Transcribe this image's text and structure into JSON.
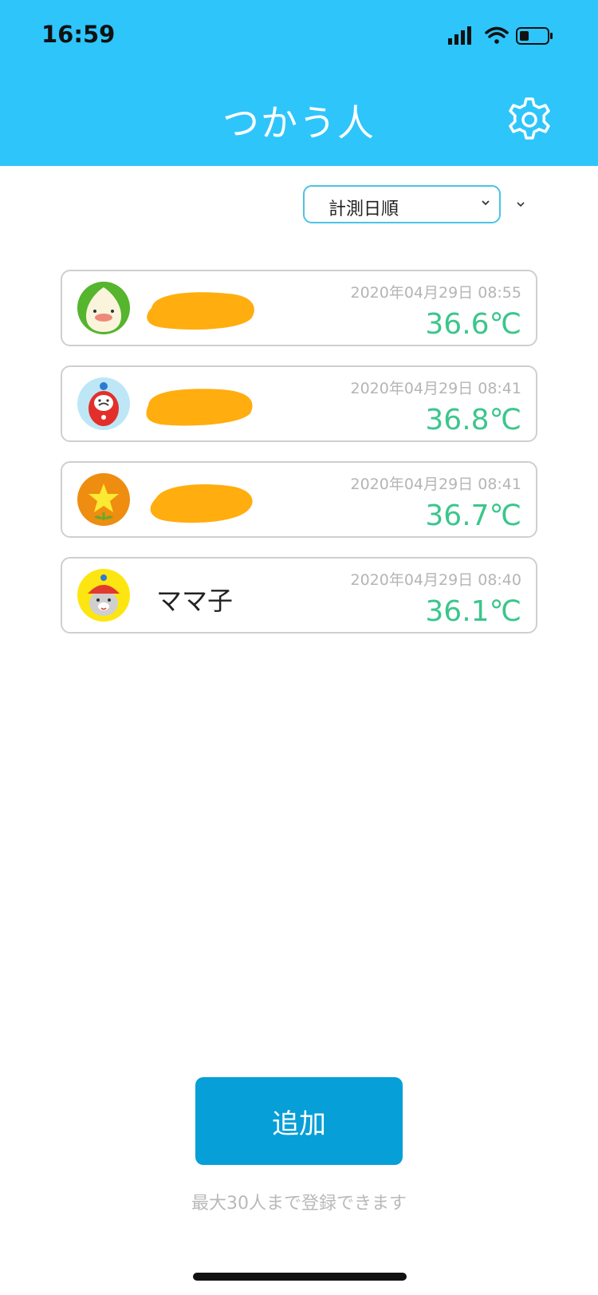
{
  "status_bar": {
    "time": "16:59"
  },
  "header": {
    "title": "つかう人",
    "settings_icon": "gear-icon"
  },
  "sort": {
    "selected": "計測日順"
  },
  "people": [
    {
      "name": "",
      "avatar": "onion-character-icon",
      "date": "2020年04月29日 08:55",
      "temp": "36.6℃"
    },
    {
      "name": "",
      "avatar": "daruma-character-icon",
      "date": "2020年04月29日 08:41",
      "temp": "36.8℃"
    },
    {
      "name": "",
      "avatar": "star-flower-icon",
      "date": "2020年04月29日 08:41",
      "temp": "36.7℃"
    },
    {
      "name": "ママ子",
      "avatar": "seal-character-icon",
      "date": "2020年04月29日 08:40",
      "temp": "36.1℃"
    }
  ],
  "add_button": {
    "label": "追加"
  },
  "note": "最大30人まで登録できます",
  "colors": {
    "header": "#2ec5fb",
    "accent_button": "#069fd7",
    "temperature": "#3bc68c",
    "redaction": "#ffad0f"
  }
}
